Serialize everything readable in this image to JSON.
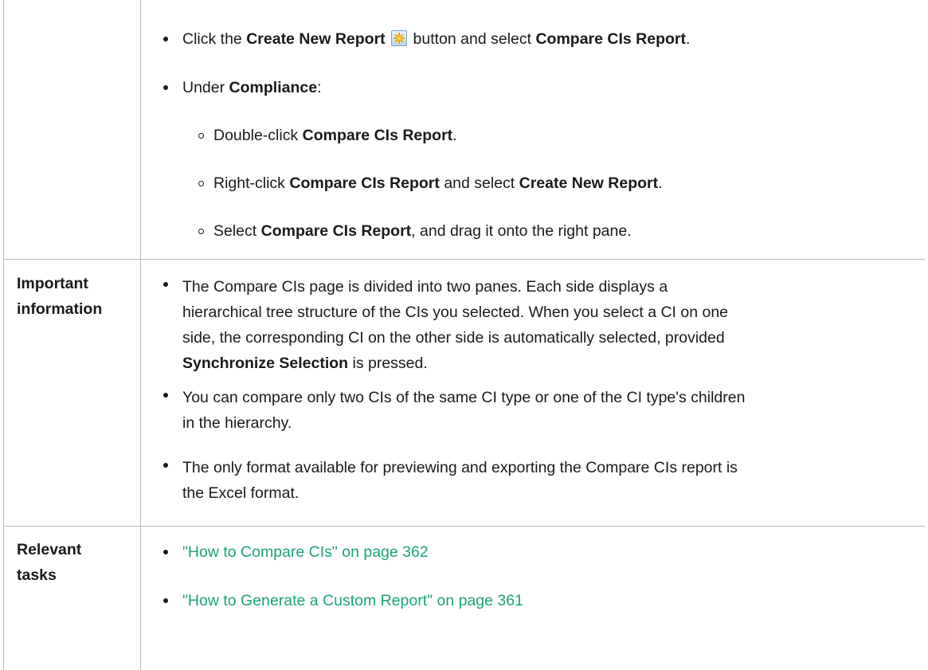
{
  "access_list": {
    "item1": {
      "pre": "Click the ",
      "b1": "Create New Report",
      "mid": " button and select ",
      "b2": "Compare CIs Report",
      "post": "."
    },
    "item2": {
      "pre": "Under ",
      "b1": "Compliance",
      "post": ":"
    },
    "sub1": {
      "pre": "Double-click ",
      "b1": "Compare CIs Report",
      "post": "."
    },
    "sub2": {
      "pre": "Right-click ",
      "b1": "Compare CIs Report",
      "mid": " and select ",
      "b2": "Create New Report",
      "post": "."
    },
    "sub3": {
      "pre": "Select ",
      "b1": "Compare CIs Report",
      "post": ", and drag it onto the right pane."
    }
  },
  "important": {
    "label_line1": "Important",
    "label_line2": "information",
    "p1_line1": "The Compare CIs page is divided into two panes. Each side displays a",
    "p1_line2": "hierarchical tree structure of the CIs you selected. When you select a CI on one",
    "p1_line3": "side, the corresponding CI on the other side is automatically selected, provided",
    "p1_bold": "Synchronize Selection",
    "p1_tail": " is pressed.",
    "p2_line1": "You can compare only two CIs of the same CI type or one of the CI type's children",
    "p2_line2": "in the hierarchy.",
    "p3_line1": "The only format available for previewing and exporting the Compare CIs report is",
    "p3_line2": "the Excel format."
  },
  "tasks": {
    "label_line1": "Relevant",
    "label_line2": "tasks",
    "link1": "\"How to Compare CIs\" on page 362",
    "link2": "\"How to Generate a Custom Report\" on page 361"
  },
  "icons": {
    "create_new_report": "create-new-report-icon"
  },
  "colors": {
    "link": "#1aa37a",
    "border": "#b8b8b8"
  }
}
